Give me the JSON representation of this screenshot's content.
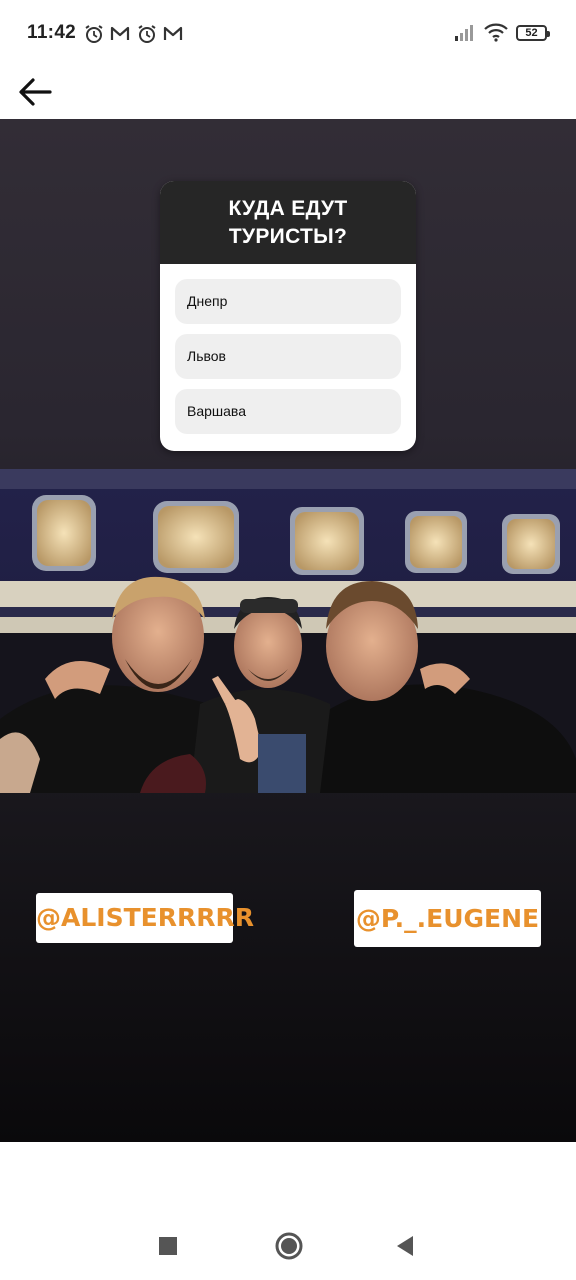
{
  "status_bar": {
    "time": "11:42",
    "left_icons": [
      "alarm-icon",
      "gmail-icon",
      "alarm-icon",
      "gmail-icon"
    ],
    "right_icons": [
      "signal-icon",
      "wifi-icon",
      "battery-icon"
    ],
    "battery_level": "52"
  },
  "app_bar": {
    "back_icon": "arrow-left-icon"
  },
  "story": {
    "quiz": {
      "question": "КУДА ЕДУТ\nТУРИСТЫ?",
      "options": [
        "Днепр",
        "Львов",
        "Варшава"
      ]
    },
    "photo": {
      "description_icon": "group-selfie-photo"
    },
    "mentions": [
      "@ALISTERRRRR",
      "@P._.EUGENE"
    ]
  },
  "nav_bar": {
    "buttons": [
      "recents-square-icon",
      "home-circle-icon",
      "back-triangle-icon"
    ]
  },
  "colors": {
    "mention_text": "#e8912d",
    "quiz_header_bg": "#262626",
    "option_bg": "#efefef"
  }
}
